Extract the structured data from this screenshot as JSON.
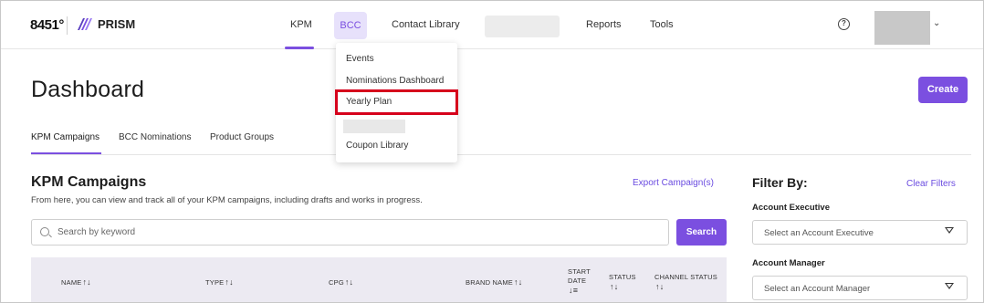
{
  "nav": {
    "brand_mark": "8451°",
    "brand_name": "PRISM",
    "items": {
      "kpm": "KPM",
      "bcc": "BCC",
      "contact_library": "Contact Library",
      "reports": "Reports",
      "tools": "Tools"
    },
    "help_glyph": "?",
    "chevron_glyph": "⌄",
    "accent_color": "#7b4fe0"
  },
  "bcc_menu": {
    "items": [
      "Events",
      "Nominations Dashboard",
      "Yearly Plan",
      "Coupon Library"
    ],
    "highlighted": "Yearly Plan",
    "highlight_color": "#d6001c"
  },
  "page": {
    "title": "Dashboard",
    "create_label": "Create"
  },
  "subtabs": [
    "KPM Campaigns",
    "BCC Nominations",
    "Product Groups"
  ],
  "section": {
    "title": "KPM Campaigns",
    "description": "From here, you can view and track all of your KPM campaigns, including drafts and works in progress.",
    "export_label": "Export Campaign(s)",
    "search_placeholder": "Search by keyword",
    "search_button": "Search"
  },
  "table": {
    "headers": {
      "name": "NAME",
      "type": "TYPE",
      "cpg": "CPG",
      "brand_name": "BRAND NAME",
      "start": "START",
      "date": "DATE",
      "status": "STATUS",
      "channel_status": "CHANNEL STATUS"
    },
    "sort_glyph": "↑↓",
    "sorted_glyph": "↓≡"
  },
  "filters": {
    "title": "Filter By:",
    "clear_label": "Clear Filters",
    "account_executive_label": "Account Executive",
    "account_executive_placeholder": "Select an Account Executive",
    "account_manager_label": "Account Manager",
    "account_manager_placeholder": "Select an Account Manager"
  }
}
